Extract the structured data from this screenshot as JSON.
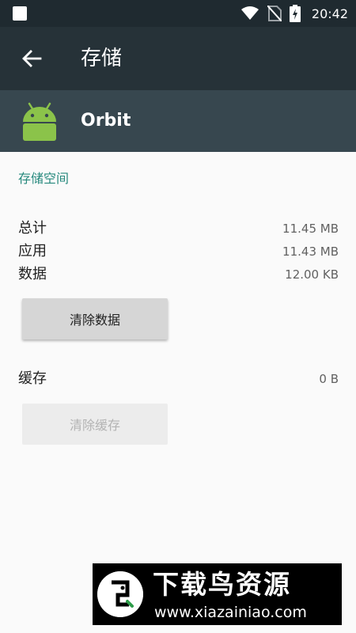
{
  "status_bar": {
    "time": "20:42",
    "icons": [
      "notification-square-icon",
      "wifi-icon",
      "no-sim-icon",
      "battery-charging-icon"
    ]
  },
  "toolbar": {
    "title": "存储",
    "back_icon": "arrow-back-icon"
  },
  "app": {
    "name": "Orbit",
    "icon": "android-icon"
  },
  "storage": {
    "section_title": "存储空间",
    "rows": [
      {
        "label": "总计",
        "value": "11.45 MB"
      },
      {
        "label": "应用",
        "value": "11.43 MB"
      },
      {
        "label": "数据",
        "value": "12.00 KB"
      }
    ],
    "clear_data_label": "清除数据",
    "cache_label": "缓存",
    "cache_value": "0 B",
    "clear_cache_label": "清除缓存"
  },
  "watermark": {
    "title": "下载鸟资源",
    "url": "www.xiazainiao.com"
  },
  "colors": {
    "status_bar": "#1f2a30",
    "toolbar": "#263238",
    "app_header": "#37474f",
    "accent": "#26897d",
    "android_green": "#8bc34a"
  }
}
